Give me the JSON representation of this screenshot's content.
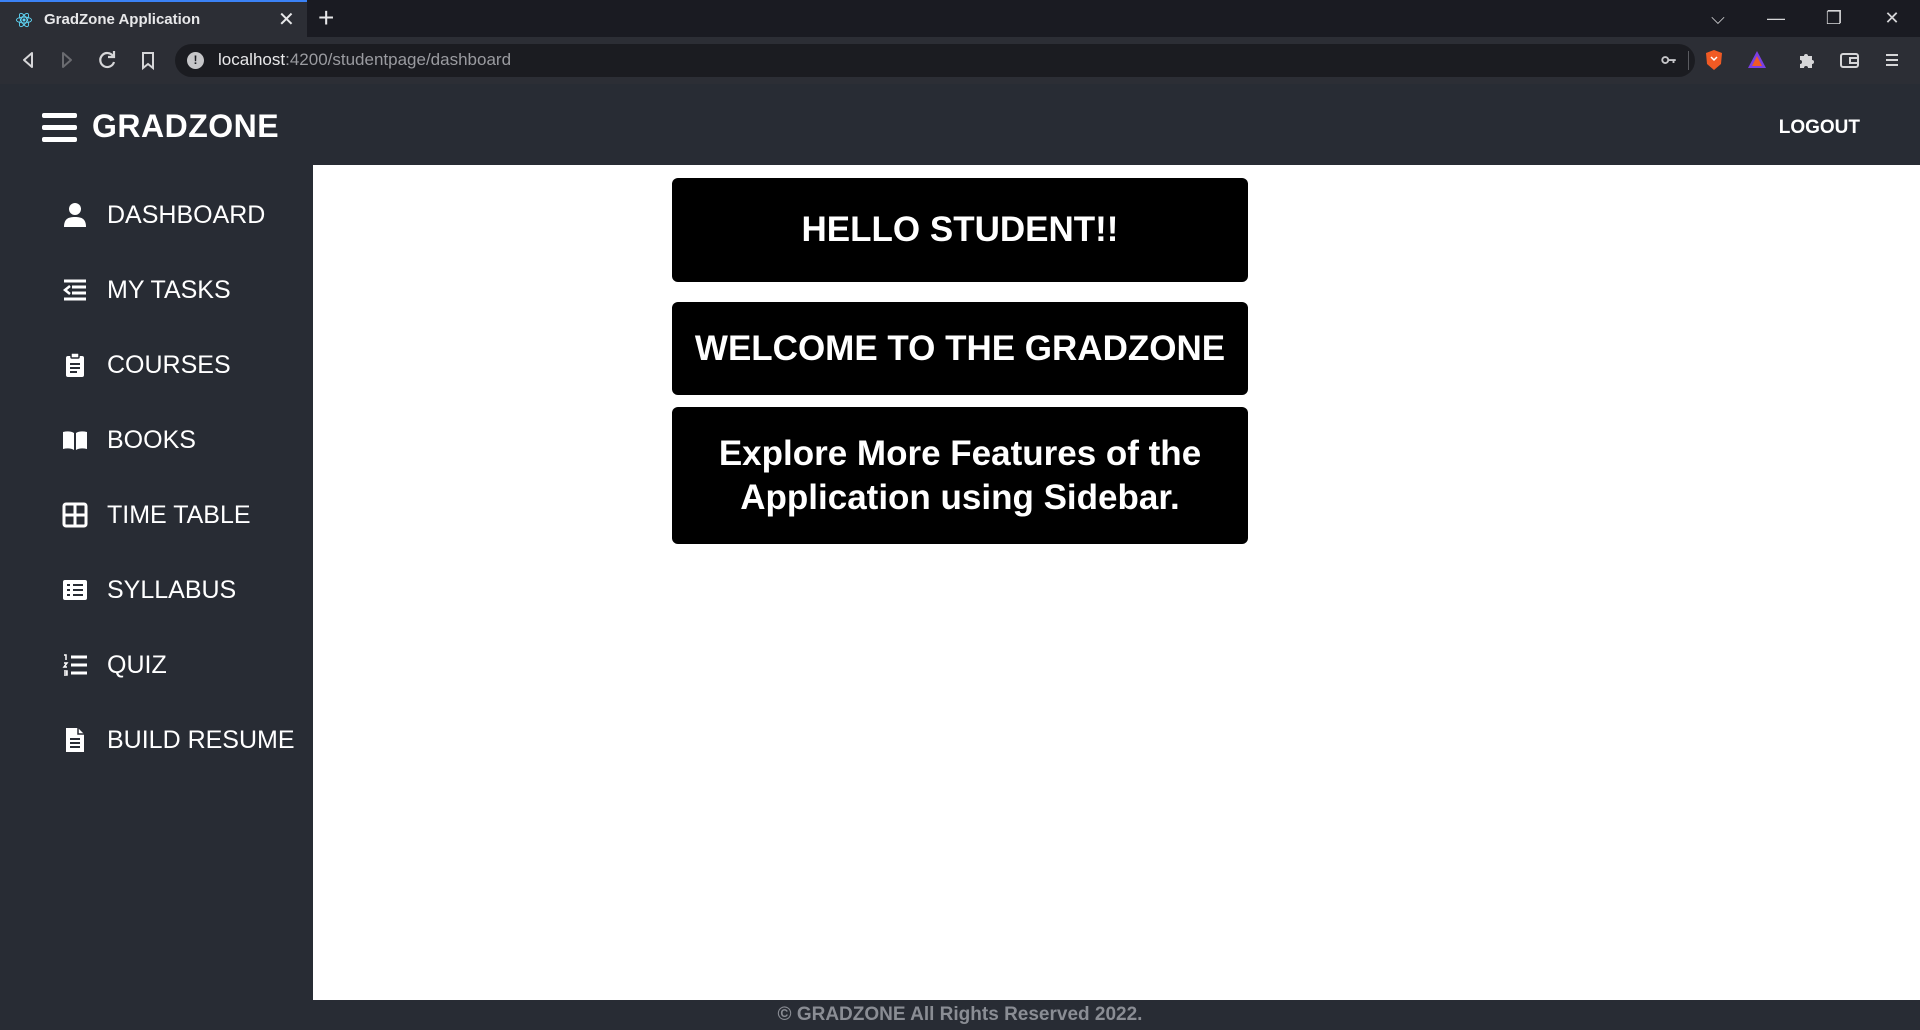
{
  "browser": {
    "tab_title": "GradZone Application",
    "tab_close": "✕",
    "new_tab": "+",
    "url_host": "localhost",
    "url_rest": ":4200/studentpage/dashboard",
    "window_controls": {
      "dropdown": "⌵",
      "minimize": "—",
      "restore": "❐",
      "close": "✕"
    }
  },
  "app": {
    "brand": "GRADZONE",
    "logout": "LOGOUT",
    "sidebar": {
      "items": [
        {
          "label": "DASHBOARD",
          "icon": "user-icon"
        },
        {
          "label": "MY TASKS",
          "icon": "task-list-icon"
        },
        {
          "label": "COURSES",
          "icon": "clipboard-icon"
        },
        {
          "label": "BOOKS",
          "icon": "book-icon"
        },
        {
          "label": "TIME TABLE",
          "icon": "grid-icon"
        },
        {
          "label": "SYLLABUS",
          "icon": "list-alt-icon"
        },
        {
          "label": "QUIZ",
          "icon": "numbered-list-icon"
        },
        {
          "label": "BUILD RESUME",
          "icon": "document-icon"
        }
      ]
    },
    "main": {
      "greeting": "HELLO STUDENT!!",
      "welcome": "WELCOME TO THE GRADZONE",
      "explore": "Explore More Features of the Application using Sidebar."
    },
    "footer": "© GRADZONE All Rights Reserved 2022."
  },
  "colors": {
    "app_bg": "#282c34",
    "card_bg": "#000000",
    "main_bg": "#ffffff"
  }
}
